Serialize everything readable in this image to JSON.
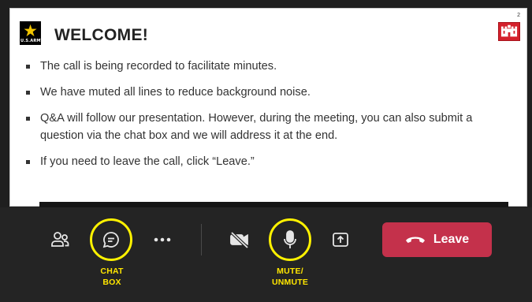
{
  "slide": {
    "page_number": "2",
    "title": "WELCOME!",
    "army_logo_text": "U.S.ARMY",
    "bullets": [
      "The call is being recorded to facilitate minutes.",
      "We have muted all lines to reduce background noise.",
      "Q&A will follow our presentation. However, during the meeting, you can also submit a question via the chat box and we will address it at the end.",
      "If you need to leave the call, click “Leave.”"
    ]
  },
  "toolbar": {
    "leave_label": "Leave",
    "callouts": {
      "chat_line1": "CHAT",
      "chat_line2": "BOX",
      "mute_line1": "MUTE/",
      "mute_line2": "UNMUTE"
    },
    "icons": [
      "people-icon",
      "chat-icon",
      "more-icon",
      "camera-off-icon",
      "microphone-icon",
      "share-tray-icon",
      "phone-hangup-icon"
    ]
  },
  "colors": {
    "leave_button": "#c4314b",
    "callout_highlight": "#fff200",
    "toolbar_bg": "#242424",
    "castle_logo": "#d4202b",
    "army_star": "#f2c500"
  }
}
